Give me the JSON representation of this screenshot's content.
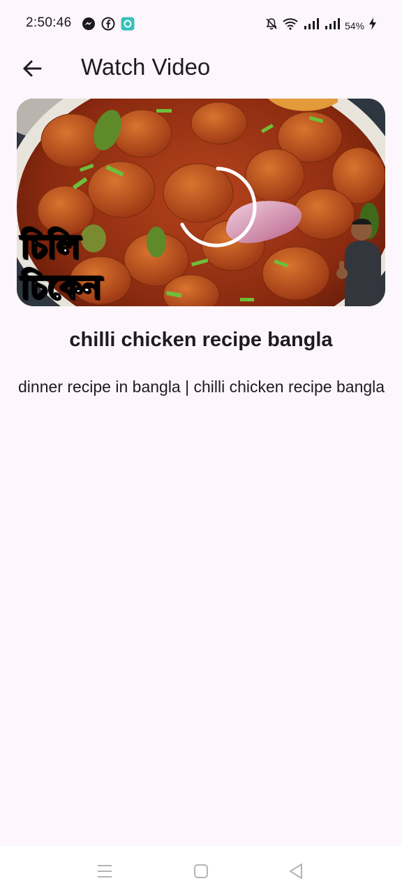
{
  "status_bar": {
    "time": "2:50:46",
    "battery": "54%",
    "left_icons": [
      "messenger-icon",
      "facebook-icon",
      "app-notification-icon"
    ],
    "right_icons": [
      "mute-bell-icon",
      "wifi-icon",
      "signal-icon",
      "signal-icon",
      "charging-icon"
    ]
  },
  "app_bar": {
    "title": "Watch Video",
    "back_icon": "arrow-left-icon"
  },
  "video": {
    "thumbnail_text_line1": "চিলি",
    "thumbnail_text_line2": "চিকেন",
    "loading": true,
    "accent_color": "#ffffff"
  },
  "content": {
    "title": "chilli chicken recipe bangla",
    "description": "dinner recipe in bangla | chilli chicken recipe bangla"
  },
  "nav_bar": {
    "icons": [
      "menu-icon",
      "home-icon",
      "back-icon"
    ]
  },
  "colors": {
    "background": "#fdf6fc",
    "text": "#1e1b20",
    "nav_background": "#ffffff"
  }
}
